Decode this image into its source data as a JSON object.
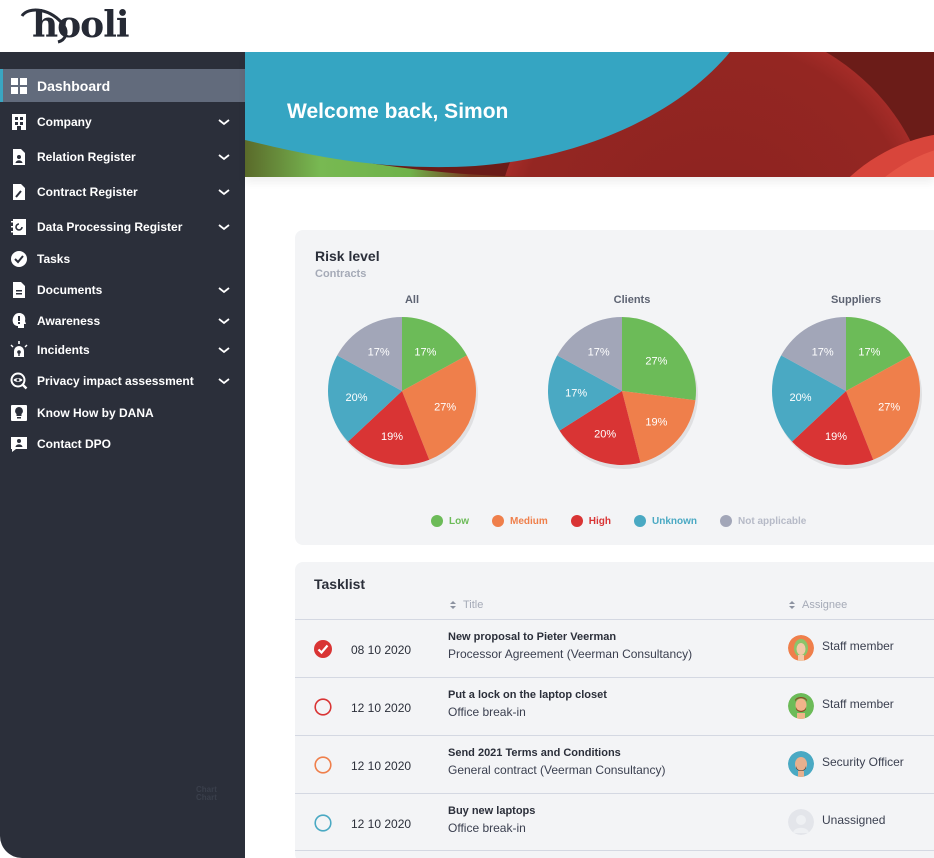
{
  "brand": {
    "logo_text": "hooli"
  },
  "sidebar": {
    "items": [
      {
        "label": "Dashboard",
        "icon": "dashboard-grid-icon",
        "expandable": false,
        "active": true
      },
      {
        "label": "Company",
        "icon": "building-icon",
        "expandable": true
      },
      {
        "label": "Relation Register",
        "icon": "contact-file-icon",
        "expandable": true
      },
      {
        "label": "Contract Register",
        "icon": "contract-pen-icon",
        "expandable": true
      },
      {
        "label": "Data Processing Register",
        "icon": "notebook-refresh-icon",
        "expandable": true
      },
      {
        "label": "Tasks",
        "icon": "check-circle-icon",
        "expandable": false
      },
      {
        "label": "Documents",
        "icon": "document-icon",
        "expandable": true
      },
      {
        "label": "Awareness",
        "icon": "head-exclamation-icon",
        "expandable": true
      },
      {
        "label": "Incidents",
        "icon": "alarm-light-icon",
        "expandable": true
      },
      {
        "label": "Privacy impact assessment",
        "icon": "eye-search-icon",
        "expandable": true
      },
      {
        "label": "Know How by DANA",
        "icon": "lightbulb-icon",
        "expandable": false
      },
      {
        "label": "Contact DPO",
        "icon": "chat-person-icon",
        "expandable": false
      }
    ],
    "watermark": [
      "Chart",
      "Chart"
    ]
  },
  "banner": {
    "welcome": "Welcome back, Simon"
  },
  "risk": {
    "title": "Risk level",
    "subtitle": "Contracts",
    "colors": {
      "Low": "#6cbb58",
      "Medium": "#ef7f4b",
      "High": "#d93434",
      "Unknown": "#4aa9c3",
      "Not applicable": "#a2a6b8"
    },
    "legend": [
      {
        "label": "Low",
        "color": "#6cbb58"
      },
      {
        "label": "Medium",
        "color": "#ef7f4b"
      },
      {
        "label": "High",
        "color": "#d93434"
      },
      {
        "label": "Unknown",
        "color": "#4aa9c3"
      },
      {
        "label": "Not applicable",
        "color": "#a2a6b8"
      }
    ]
  },
  "chart_data": [
    {
      "type": "pie",
      "title": "All",
      "categories": [
        "Low",
        "Medium",
        "High",
        "Unknown",
        "Not applicable"
      ],
      "values": [
        17,
        27,
        19,
        20,
        17
      ],
      "labels": [
        "17%",
        "27%",
        "19%",
        "20%",
        "17%"
      ]
    },
    {
      "type": "pie",
      "title": "Clients",
      "categories": [
        "Low",
        "Medium",
        "High",
        "Unknown",
        "Not applicable"
      ],
      "values": [
        27,
        19,
        20,
        17,
        17
      ],
      "labels": [
        "27%",
        "19%",
        "20%",
        "17%",
        "17%"
      ]
    },
    {
      "type": "pie",
      "title": "Suppliers",
      "categories": [
        "Low",
        "Medium",
        "High",
        "Unknown",
        "Not applicable"
      ],
      "values": [
        17,
        27,
        19,
        20,
        17
      ],
      "labels": [
        "17%",
        "27%",
        "19%",
        "20%",
        "17%"
      ]
    }
  ],
  "tasklist": {
    "title": "Tasklist",
    "columns": {
      "title": "Title",
      "assignee": "Assignee"
    },
    "rows": [
      {
        "status": "done",
        "status_color": "#d93434",
        "date": "08 10 2020",
        "title": "New proposal to Pieter Veerman",
        "subtitle": "Processor Agreement (Veerman Consultancy)",
        "assignee": "Staff member",
        "avatar": "avatar-woman-green-hair",
        "avatar_bg": "#ef7f4b"
      },
      {
        "status": "open",
        "status_color": "#d93434",
        "date": "12 10 2020",
        "title": "Put a lock on the laptop closet",
        "subtitle": "Office break-in",
        "assignee": "Staff member",
        "avatar": "avatar-man-beard",
        "avatar_bg": "#6cbb58"
      },
      {
        "status": "open",
        "status_color": "#ef7f4b",
        "date": "12 10 2020",
        "title": "Send 2021 Terms and Conditions",
        "subtitle": "General contract (Veerman Consultancy)",
        "assignee": "Security Officer",
        "avatar": "avatar-bald-man",
        "avatar_bg": "#4aa9c3"
      },
      {
        "status": "open",
        "status_color": "#4aa9c3",
        "date": "12 10 2020",
        "title": "Buy new laptops",
        "subtitle": "Office break-in",
        "assignee": "Unassigned",
        "avatar": "avatar-placeholder",
        "avatar_bg": "#e3e5ea"
      }
    ]
  }
}
